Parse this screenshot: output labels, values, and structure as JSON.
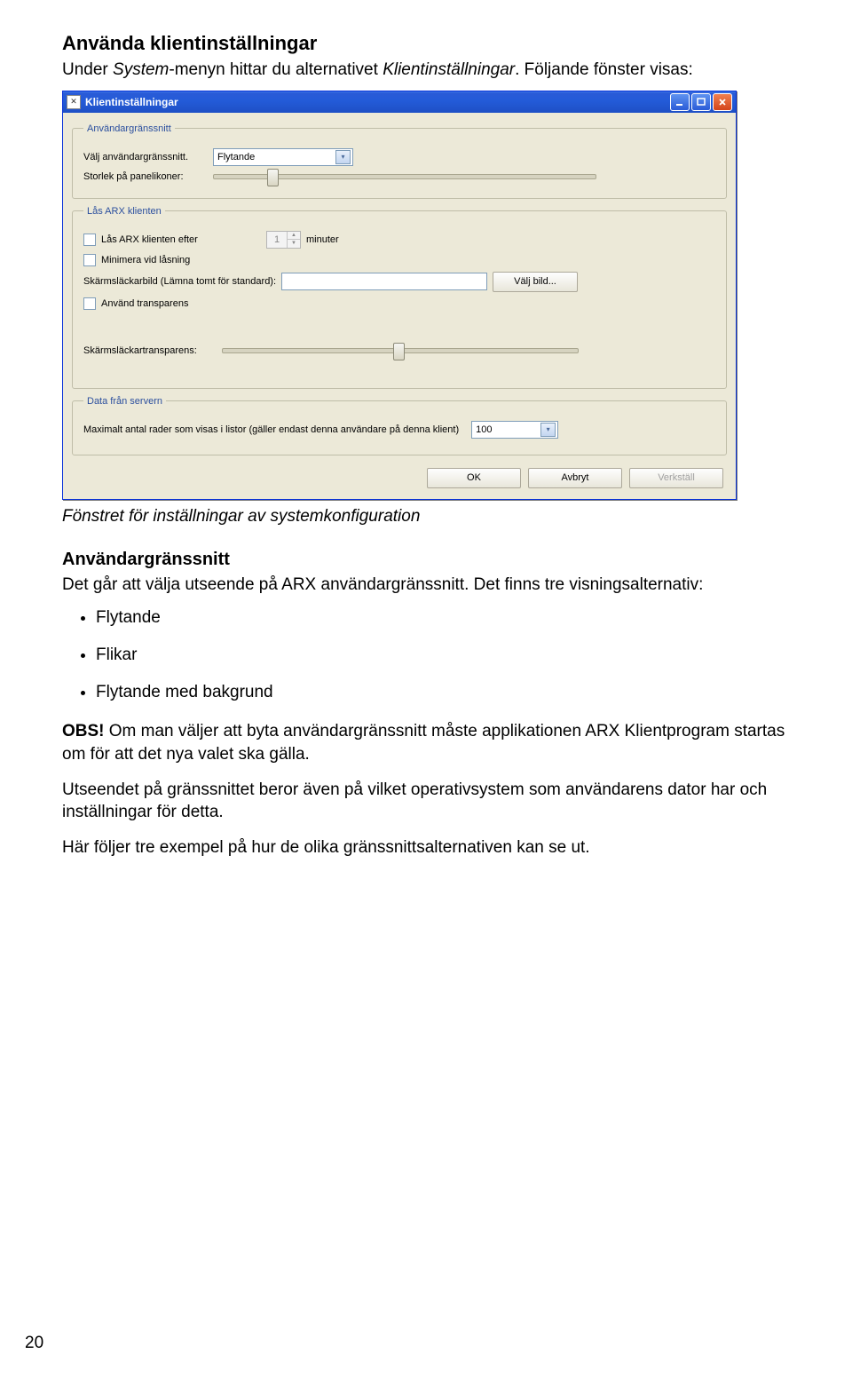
{
  "doc": {
    "heading": "Använda klientinställningar",
    "intro_pre": "Under ",
    "intro_em1": "System",
    "intro_mid": "-menyn hittar du alternativet ",
    "intro_em2": "Klientinställningar",
    "intro_post": ". Följande fönster visas:",
    "caption": "Fönstret för inställningar av systemkonfiguration",
    "subhead": "Användargränssnitt",
    "p1": "Det går att välja utseende på ARX användargränssnitt. Det finns tre visningsalternativ:",
    "bullets": [
      "Flytande",
      "Flikar",
      "Flytande med bakgrund"
    ],
    "obs_label": "OBS!",
    "obs_text": " Om man väljer att byta användargränssnitt måste applikationen ARX Klientprogram startas om för att det nya valet ska gälla.",
    "p2": "Utseendet på gränssnittet beror även på vilket operativsystem som användarens dator har och inställningar för detta.",
    "p3": "Här följer tre exempel på hur de olika gränssnittsalternativen kan se ut.",
    "page_number": "20"
  },
  "win": {
    "title": "Klientinställningar",
    "app_icon_glyph": "✕",
    "group1": {
      "legend": "Användargränssnitt",
      "lbl_interface": "Välj användargränssnitt.",
      "combo_value": "Flytande",
      "lbl_iconsize": "Storlek på panelikoner:"
    },
    "group2": {
      "legend": "Lås ARX klienten",
      "chk_lock": "Lås ARX klienten efter",
      "spinner_value": "1",
      "lbl_minutes": "minuter",
      "chk_minimize": "Minimera vid låsning",
      "lbl_screensaver": "Skärmsläckarbild (Lämna tomt för standard):",
      "btn_choose": "Välj bild...",
      "chk_transparency": "Använd transparens",
      "lbl_transparency_slider": "Skärmsläckartransparens:"
    },
    "group3": {
      "legend": "Data från servern",
      "lbl_maxrows": "Maximalt antal rader som visas i listor (gäller endast denna användare på denna klient)",
      "combo_value": "100"
    },
    "footer": {
      "ok": "OK",
      "cancel": "Avbryt",
      "apply": "Verkställ"
    }
  }
}
